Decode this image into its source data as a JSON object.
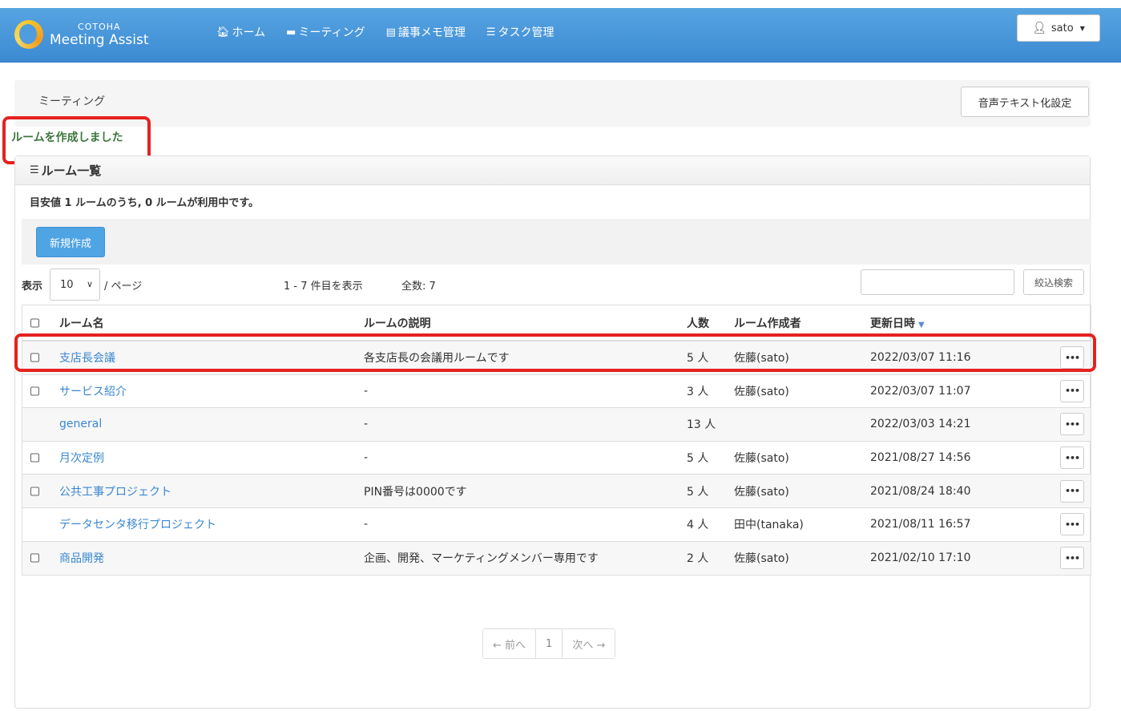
{
  "brand": {
    "top": "COTOHA",
    "bottom": "Meeting Assist"
  },
  "nav": {
    "home": "ホーム",
    "meeting": "ミーティング",
    "minutes": "議事メモ管理",
    "tasks": "タスク管理",
    "user": "sato"
  },
  "breadcrumb": {
    "title": "ミーティング",
    "voice_button": "音声テキスト化設定"
  },
  "flash": "ルームを作成しました",
  "panel": {
    "title": "ルーム一覧",
    "summary": "目安値 1 ルームのうち, 0 ルームが利用中です。",
    "new_button": "新規作成"
  },
  "controls": {
    "show_label": "表示",
    "per_page": "10",
    "page_unit": "/ ページ",
    "range": "1 - 7 件目を表示",
    "total": "全数: 7",
    "search_placeholder": "",
    "search_button": "絞込検索"
  },
  "table": {
    "headers": {
      "name": "ルーム名",
      "desc": "ルームの説明",
      "count": "人数",
      "creator": "ルーム作成者",
      "updated": "更新日時"
    },
    "rows": [
      {
        "name": "支店長会議",
        "desc": "各支店長の会議用ルームです",
        "count": "5 人",
        "creator": "佐藤(sato)",
        "updated": "2022/03/07 11:16",
        "checkbox": true
      },
      {
        "name": "サービス紹介",
        "desc": "-",
        "count": "3 人",
        "creator": "佐藤(sato)",
        "updated": "2022/03/07 11:07",
        "checkbox": true
      },
      {
        "name": "general",
        "desc": "-",
        "count": "13 人",
        "creator": "",
        "updated": "2022/03/03 14:21",
        "checkbox": false
      },
      {
        "name": "月次定例",
        "desc": "-",
        "count": "5 人",
        "creator": "佐藤(sato)",
        "updated": "2021/08/27 14:56",
        "checkbox": true
      },
      {
        "name": "公共工事プロジェクト",
        "desc": "PIN番号は0000です",
        "count": "5 人",
        "creator": "佐藤(sato)",
        "updated": "2021/08/24 18:40",
        "checkbox": true
      },
      {
        "name": "データセンタ移行プロジェクト",
        "desc": "-",
        "count": "4 人",
        "creator": "田中(tanaka)",
        "updated": "2021/08/11 16:57",
        "checkbox": false
      },
      {
        "name": "商品開発",
        "desc": "企画、開発、マーケティングメンバー専用です",
        "count": "2 人",
        "creator": "佐藤(sato)",
        "updated": "2021/02/10 17:10",
        "checkbox": true
      }
    ],
    "more_label": "•••"
  },
  "pagination": {
    "prev": "← 前へ",
    "current": "1",
    "next": "次へ →"
  },
  "colors": {
    "navbar": "#4a98dc",
    "link": "#3a87d1",
    "flash": "#3c763d",
    "highlight": "#e5221f"
  }
}
